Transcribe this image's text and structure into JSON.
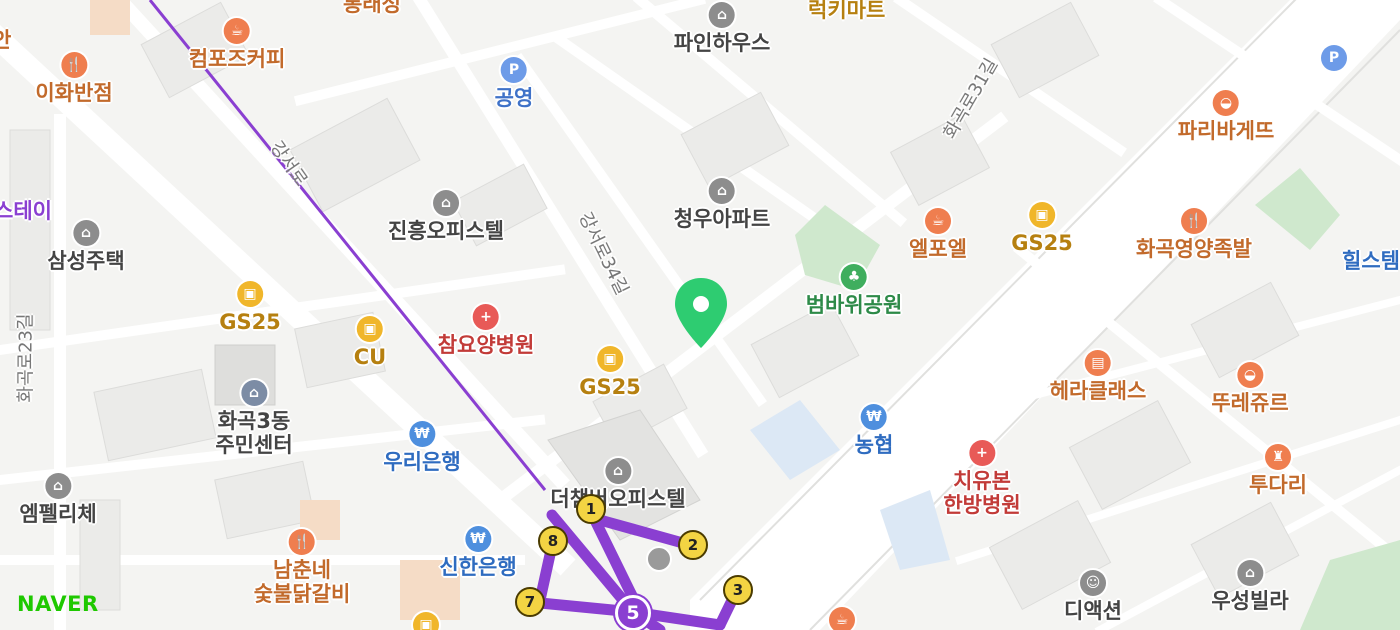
{
  "brand": {
    "logo_text": "NAVER",
    "color": "#1ec800"
  },
  "map_type": "street map",
  "location_pin": {
    "color": "#2ecc71"
  },
  "pois": [
    {
      "name": "컴포즈커피",
      "category": "cafe",
      "icon": "cafe-icon"
    },
    {
      "name": "이화반점",
      "category": "restaurant",
      "icon": "restaurant-icon"
    },
    {
      "name": "공영",
      "category": "parking",
      "icon": "parking-icon"
    },
    {
      "name": "파인하우스",
      "category": "building",
      "icon": "building-icon"
    },
    {
      "name": "청우아파트",
      "category": "building",
      "icon": "building-icon"
    },
    {
      "name": "진흥오피스텔",
      "category": "building",
      "icon": "building-icon"
    },
    {
      "name": "삼성주택",
      "category": "building",
      "icon": "building-icon"
    },
    {
      "name": "GS25",
      "category": "convenience",
      "icon": "convenience-store-icon"
    },
    {
      "name": "CU",
      "category": "convenience",
      "icon": "convenience-store-icon"
    },
    {
      "name": "참요양병원",
      "category": "hospital",
      "icon": "hospital-icon"
    },
    {
      "name": "GS25",
      "category": "convenience",
      "icon": "convenience-store-icon"
    },
    {
      "name": "화곡3동\n주민센터",
      "category": "government",
      "icon": "government-icon"
    },
    {
      "name": "우리은행",
      "category": "bank",
      "icon": "bank-icon"
    },
    {
      "name": "더챔버오피스텔",
      "category": "building",
      "icon": "building-icon"
    },
    {
      "name": "엠펠리체",
      "category": "building",
      "icon": "building-icon"
    },
    {
      "name": "남춘네\n숯불닭갈비",
      "category": "restaurant",
      "icon": "restaurant-icon"
    },
    {
      "name": "신한은행",
      "category": "bank",
      "icon": "bank-icon"
    },
    {
      "name": "엘포엘",
      "category": "cafe",
      "icon": "cafe-icon"
    },
    {
      "name": "GS25",
      "category": "convenience",
      "icon": "convenience-store-icon"
    },
    {
      "name": "범바위공원",
      "category": "park",
      "icon": "park-icon"
    },
    {
      "name": "농협",
      "category": "bank",
      "icon": "bank-icon"
    },
    {
      "name": "파리바게뜨",
      "category": "bakery",
      "icon": "bakery-icon"
    },
    {
      "name": "화곡영양족발",
      "category": "restaurant",
      "icon": "restaurant-icon"
    },
    {
      "name": "헤라클래스",
      "category": "gym",
      "icon": "gym-icon"
    },
    {
      "name": "뚜레쥬르",
      "category": "bakery",
      "icon": "bakery-icon"
    },
    {
      "name": "치유본\n한방병원",
      "category": "hospital",
      "icon": "hospital-icon"
    },
    {
      "name": "투다리",
      "category": "pub",
      "icon": "pub-icon"
    },
    {
      "name": "디액션",
      "category": "theater",
      "icon": "theater-icon"
    },
    {
      "name": "우성빌라",
      "category": "building",
      "icon": "building-icon"
    }
  ],
  "partial_labels": [
    "롱래성",
    "럭키마트",
    "스테이",
    "힐스템",
    "안"
  ],
  "streets": [
    "강서로",
    "강서로34길",
    "화곡로31길",
    "화곡로23길"
  ],
  "subway": {
    "station_number": "5",
    "line_color": "#8a3fd1",
    "exits": [
      "1",
      "2",
      "3",
      "7",
      "8"
    ]
  },
  "misc": {
    "parking_symbol": "P",
    "bank_symbol": "₩",
    "medical_symbol": "+"
  }
}
